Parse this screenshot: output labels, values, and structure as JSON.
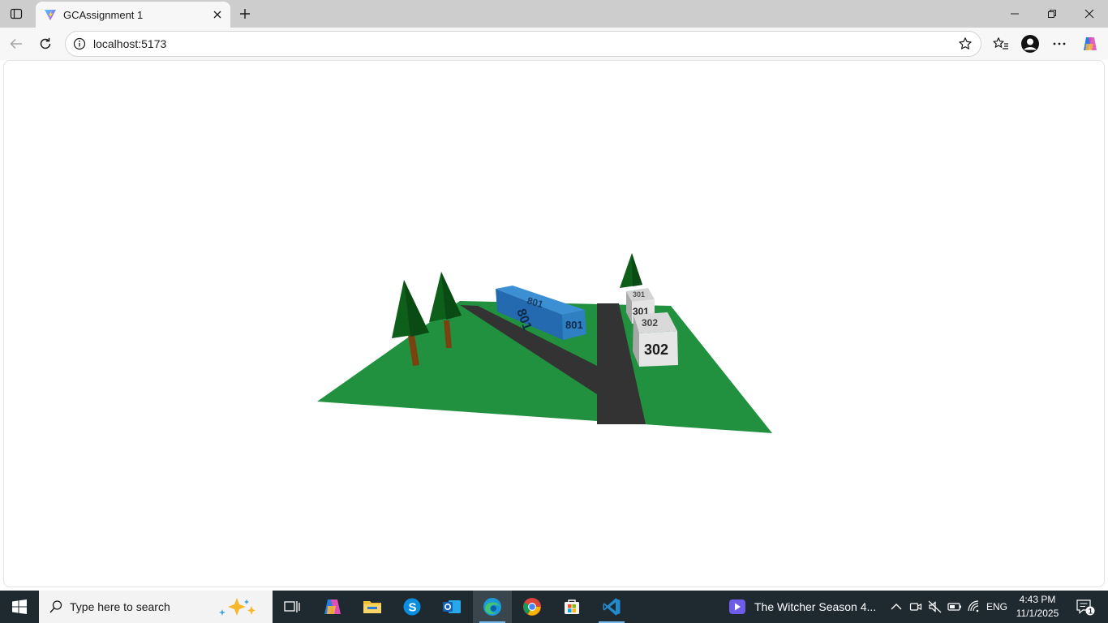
{
  "browser": {
    "tab_title": "GCAssignment 1",
    "url": "localhost:5173"
  },
  "scene": {
    "description_labels": {
      "container_top": "801",
      "container_side": "801",
      "box_far_top": "301",
      "box_far_front": "301",
      "box_near_top": "302",
      "box_near_front": "302"
    },
    "colors": {
      "ground": "#21913f",
      "road": "#333333",
      "container": "#2f7fc3",
      "tree_foliage": "#0e5f1a",
      "tree_trunk": "#7a4210",
      "box": "#e4e4e4"
    }
  },
  "taskbar": {
    "search_placeholder": "Type here to search",
    "media_title": "The Witcher Season 4...",
    "language": "ENG",
    "time": "4:43 PM",
    "date": "11/1/2025",
    "notification_count": "1",
    "apps": [
      "task-view",
      "copilot",
      "file-explorer",
      "skype",
      "outlook",
      "edge",
      "chrome",
      "microsoft-store",
      "vscode"
    ]
  }
}
